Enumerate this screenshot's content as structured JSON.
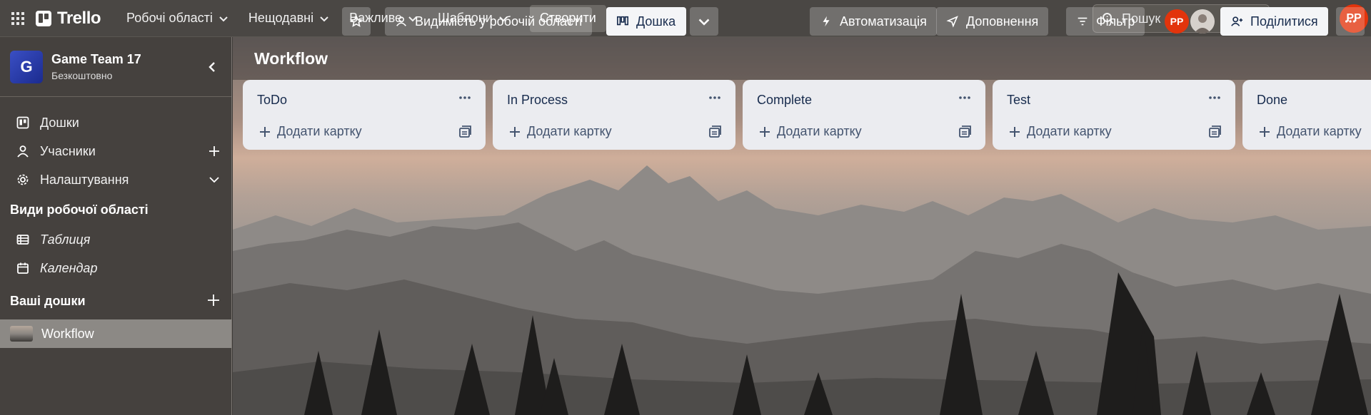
{
  "header": {
    "app_name": "Trello",
    "nav": [
      {
        "label": "Робочі області"
      },
      {
        "label": "Нещодавні"
      },
      {
        "label": "Важливе"
      },
      {
        "label": "Шаблони"
      }
    ],
    "create_label": "Створити",
    "search_placeholder": "Пошук",
    "user_initials": "PP",
    "icons": [
      "apps-grid-icon",
      "trello-logo-icon",
      "chevron-down-icon",
      "search-icon",
      "info-icon",
      "bell-icon"
    ]
  },
  "sidebar": {
    "workspace_initial": "G",
    "workspace_name": "Game Team 17",
    "workspace_plan": "Безкоштовно",
    "items": [
      {
        "label": "Дошки",
        "icon": "board-icon"
      },
      {
        "label": "Учасники",
        "icon": "person-icon"
      },
      {
        "label": "Налаштування",
        "icon": "gear-icon"
      }
    ],
    "views_heading": "Види робочої області",
    "views": [
      {
        "label": "Таблиця",
        "icon": "table-icon"
      },
      {
        "label": "Календар",
        "icon": "calendar-icon"
      }
    ],
    "boards_heading": "Ваші дошки",
    "boards": [
      {
        "label": "Workflow"
      }
    ]
  },
  "board": {
    "title": "Workflow",
    "visibility_label": "Видимість у робочій області",
    "view_label": "Дошка",
    "automation_label": "Автоматизація",
    "powerups_label": "Доповнення",
    "filter_label": "Фільтр",
    "member_initials": "PP",
    "share_label": "Поділитися"
  },
  "lists": [
    {
      "title": "ToDo",
      "add_label": "Додати картку"
    },
    {
      "title": "In Process",
      "add_label": "Додати картку"
    },
    {
      "title": "Complete",
      "add_label": "Додати картку"
    },
    {
      "title": "Test",
      "add_label": "Додати картку"
    },
    {
      "title": "Done",
      "add_label": "Додати картку"
    }
  ],
  "colors": {
    "header_bg": "#4a4744",
    "avatar_red": "#e2340c",
    "workspace_blue": "#2a3fb0",
    "list_bg": "#ebecf0",
    "list_text": "#172b4d"
  }
}
